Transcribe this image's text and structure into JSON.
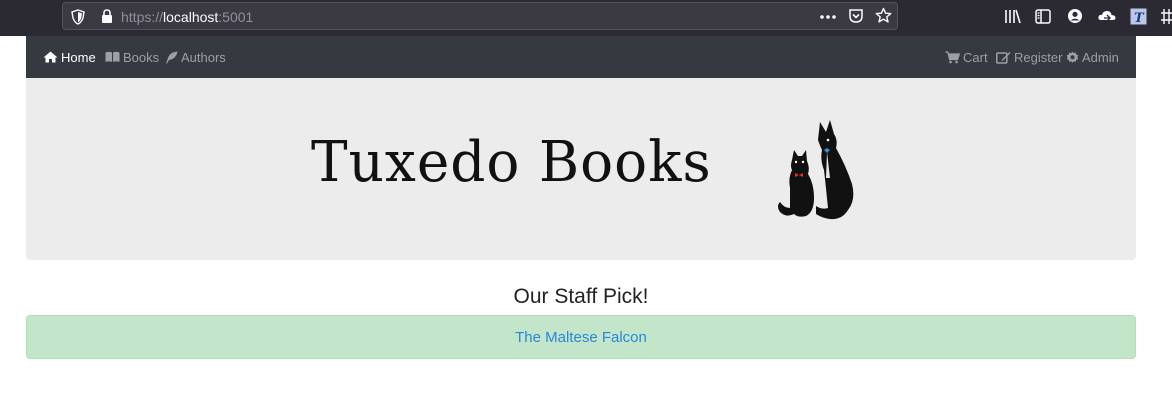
{
  "browser": {
    "url_scheme": "https://",
    "url_host": "localhost",
    "url_port": ":5001",
    "icons": [
      "shield-icon",
      "lock-icon",
      "more-icon",
      "pocket-icon",
      "bookmark-star-icon",
      "library-icon",
      "sidebar-icon",
      "account-icon",
      "sync-icon",
      "extension-icon"
    ]
  },
  "navbar": {
    "left": [
      {
        "label": "Home",
        "icon": "home-icon",
        "active": true
      },
      {
        "label": "Books",
        "icon": "book-icon",
        "active": false
      },
      {
        "label": "Authors",
        "icon": "feather-icon",
        "active": false
      }
    ],
    "right": [
      {
        "label": "Cart",
        "icon": "cart-icon"
      },
      {
        "label": "Register",
        "icon": "edit-icon"
      },
      {
        "label": "Admin",
        "icon": "gear-icon"
      }
    ],
    "bg_color": "#343a40"
  },
  "jumbotron": {
    "logo_text": "Tuxedo Books"
  },
  "staff_pick": {
    "heading": "Our Staff Pick!",
    "book_title": "The Maltese Falcon",
    "alert_color": "#c3e6cb",
    "link_color": "#2a86d8"
  }
}
